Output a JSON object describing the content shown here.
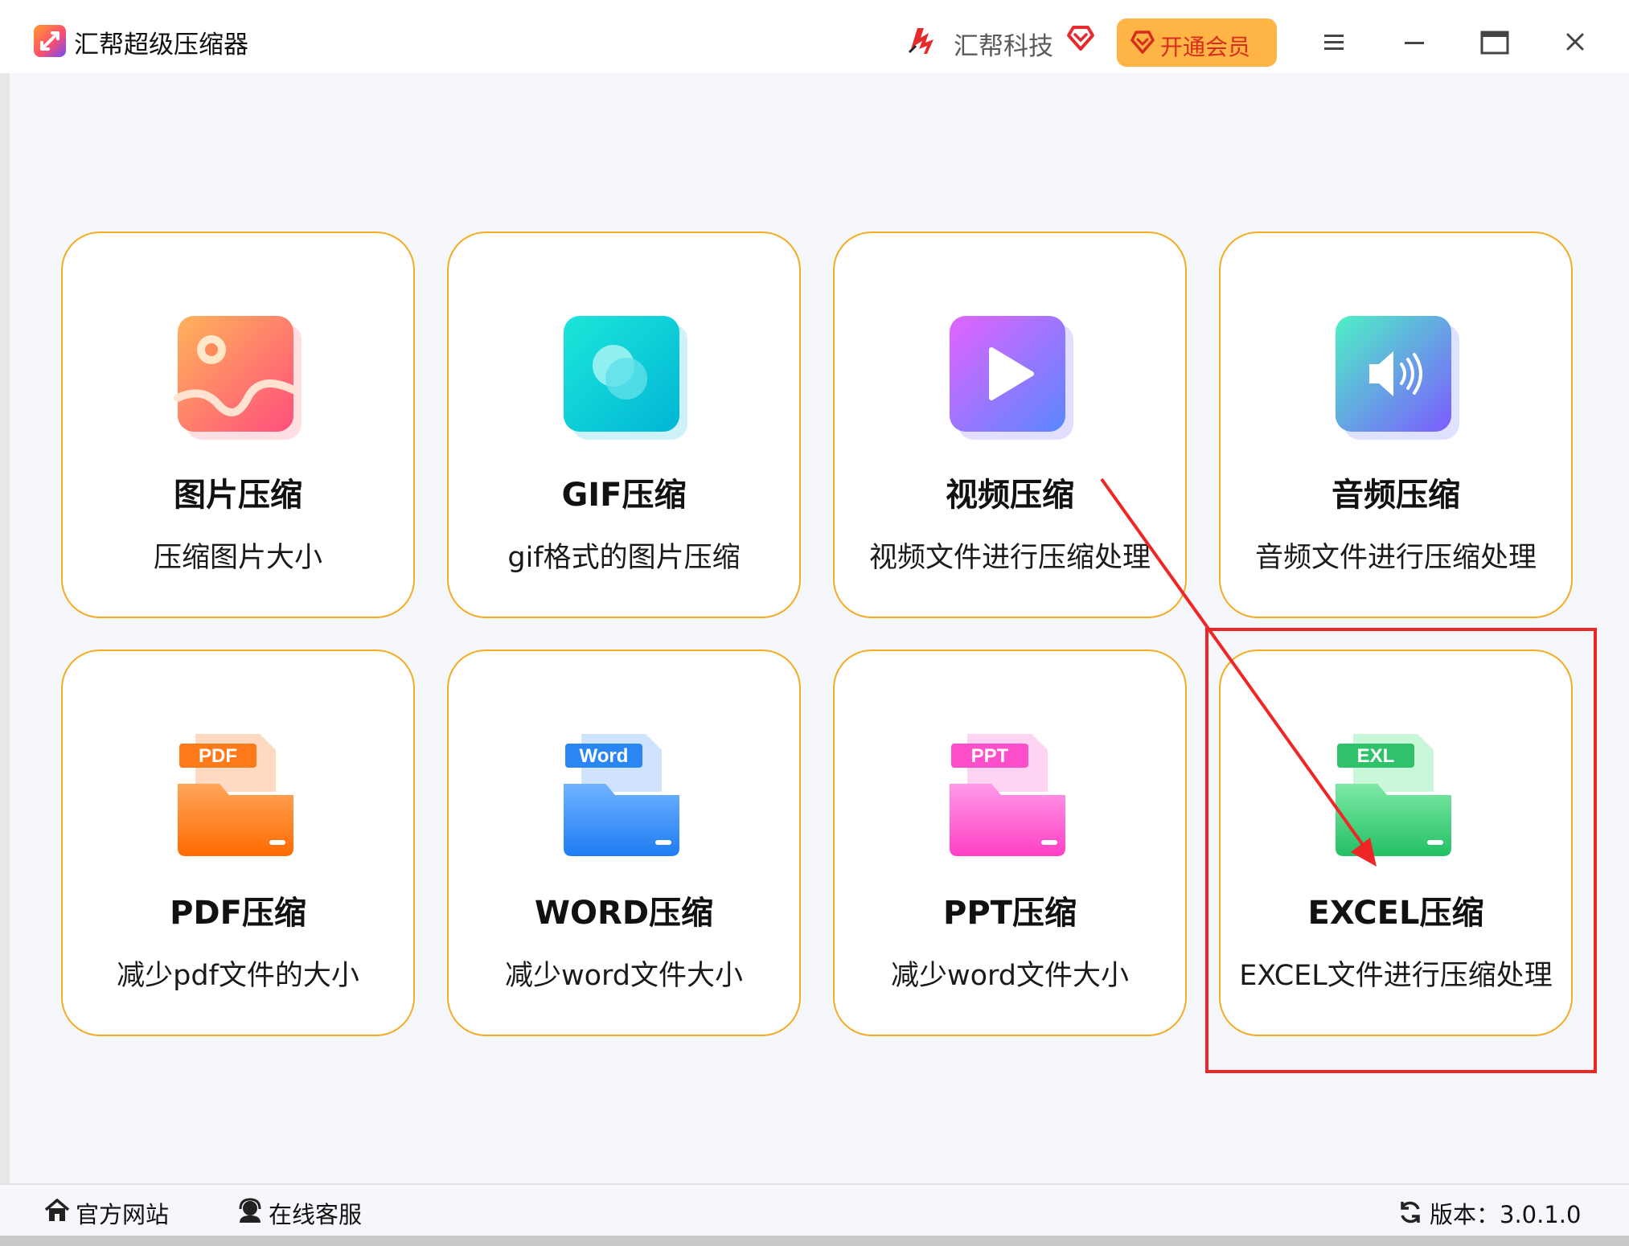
{
  "app": {
    "title": "汇帮超级压缩器"
  },
  "header": {
    "brand_name": "汇帮科技",
    "vip_label": "开通会员",
    "menu_icon": "hamburger-menu-icon",
    "minimize_icon": "minimize-icon",
    "maximize_icon": "maximize-icon",
    "close_icon": "close-icon"
  },
  "cards": [
    {
      "title": "图片压缩",
      "desc": "压缩图片大小",
      "icon": "image-icon"
    },
    {
      "title": "GIF压缩",
      "desc": "gif格式的图片压缩",
      "icon": "gif-icon"
    },
    {
      "title": "视频压缩",
      "desc": "视频文件进行压缩处理",
      "icon": "video-play-icon"
    },
    {
      "title": "音频压缩",
      "desc": "音频文件进行压缩处理",
      "icon": "speaker-icon"
    },
    {
      "title": "PDF压缩",
      "desc": "减少pdf文件的大小",
      "icon": "pdf-folder-icon",
      "badge": "PDF"
    },
    {
      "title": "WORD压缩",
      "desc": "减少word文件大小",
      "icon": "word-folder-icon",
      "badge": "Word"
    },
    {
      "title": "PPT压缩",
      "desc": "减少word文件大小",
      "icon": "ppt-folder-icon",
      "badge": "PPT"
    },
    {
      "title": "EXCEL压缩",
      "desc": "EXCEL文件进行压缩处理",
      "icon": "excel-folder-icon",
      "badge": "EXL"
    }
  ],
  "footer": {
    "website_label": "官方网站",
    "support_label": "在线客服",
    "version_label": "版本：3.0.1.0"
  },
  "colors": {
    "card_border": "#f6ab25",
    "vip_bg": "#ffb446",
    "annotation_red": "#ee2626"
  }
}
